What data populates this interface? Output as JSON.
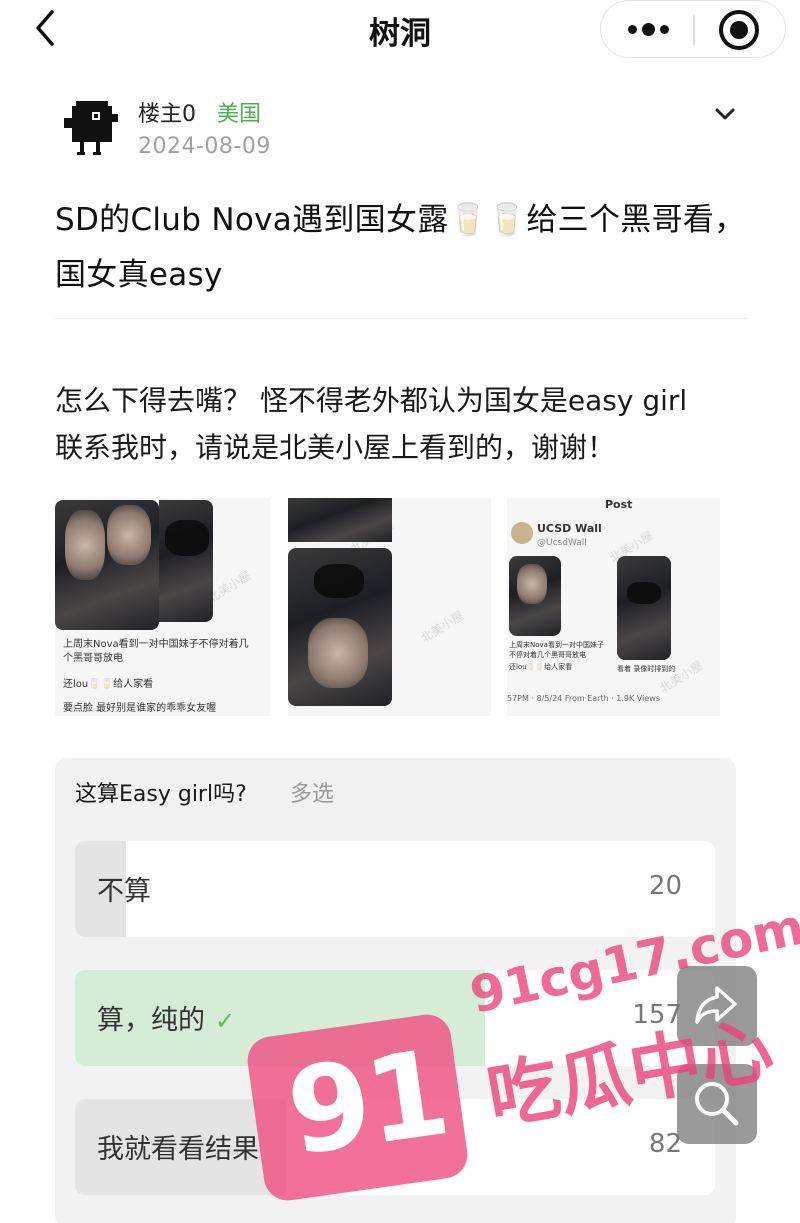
{
  "nav": {
    "title": "树洞",
    "back_icon": "chevron-left-icon",
    "more_icon": "more-dots-icon",
    "close_icon": "target-circle-icon"
  },
  "post": {
    "author": "楼主0",
    "location": "美国",
    "date": "2024-08-09",
    "title": "SD的Club Nova遇到国女露🥛🥛给三个黑哥看， 国女真easy",
    "body_line1": "怎么下得去嘴？ 怪不得老外都认为国女是easy girl",
    "body_line2": "联系我时，请说是北美小屋上看到的，谢谢！"
  },
  "images": {
    "img1_caption1": "上周末Nova看到一对中国妹子不停对着几个黑哥哥放电",
    "img1_caption2": "还lou🥛🥛给人家看",
    "img1_caption3": "要点脸 最好别是谁家的乖乖女友喔",
    "img3_header": "Post",
    "img3_account": "UCSD Wall",
    "img3_handle": "@UcsdWall",
    "img3_caption_left": "上周末Nova看到一对中国妹子不停对着几个黑哥哥放电",
    "img3_caption_left2": "还lou🥛🥛给人家看",
    "img3_caption_right": "看着 录像时排到的",
    "img3_footer": "57PM · 8/5/24 From Earth · 1.9K Views",
    "watermark_text": "北美小屋"
  },
  "poll": {
    "question": "这算Easy girl吗?",
    "tag": "多选",
    "options": [
      {
        "label": "不算",
        "count": "20",
        "fraction": 0.08,
        "selected": false
      },
      {
        "label": "算，纯的",
        "count": "157",
        "fraction": 0.64,
        "selected": true
      },
      {
        "label": "我就看看结果",
        "count": "82",
        "fraction": 0.33,
        "selected": false
      }
    ],
    "fill_color": "#e4e4e4",
    "selected_fill_color": "#d5ecd6"
  },
  "floating": {
    "share_icon": "share-arrow-icon",
    "search_icon": "search-icon"
  },
  "overlay_watermark": {
    "url": "91cg17.com",
    "badge": "91",
    "brand": "吃瓜中心"
  }
}
